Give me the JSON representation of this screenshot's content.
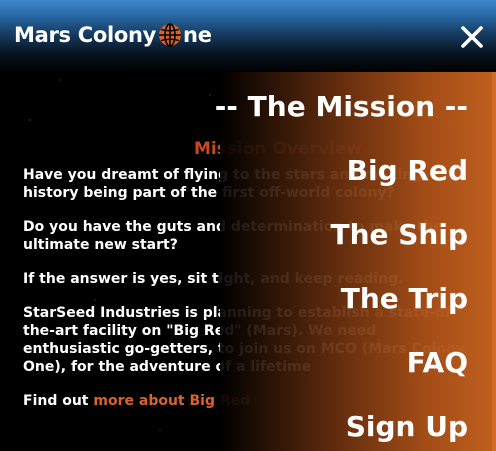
{
  "header": {
    "logo_text_before": "Mars Colony",
    "logo_text_after": "ne",
    "logo_icon": "globe-icon",
    "close_icon": "close-icon",
    "colors": {
      "header_top": "#3f88c8",
      "header_bottom": "#000000",
      "globe": "#d9632b"
    }
  },
  "menu": {
    "items": [
      {
        "label": "-- The Mission --"
      },
      {
        "label": "Big Red"
      },
      {
        "label": "The Ship"
      },
      {
        "label": "The Trip"
      },
      {
        "label": "FAQ"
      },
      {
        "label": "Sign Up"
      }
    ],
    "colors": {
      "accent": "#c0601f"
    }
  },
  "main": {
    "title": "Mission Overview",
    "paragraphs": [
      "Have you dreamt of flying to the stars and making history being part of the first off-world colony?",
      "Do you have the guts and determination to make the ultimate new start?",
      "If the answer is yes, sit tight, and keep reading.",
      "StarSeed Industries is planning to establish a state-of-the-art facility on \"Big Red\" (Mars). We need enthusiastic go-getters, to join us on MCO (Mars Colony One), for the adventure of a lifetime"
    ],
    "find_out_prefix": "Find out ",
    "find_out_link": "more about Big Red",
    "colors": {
      "title": "#c44a1e",
      "link": "#d9632b"
    }
  }
}
